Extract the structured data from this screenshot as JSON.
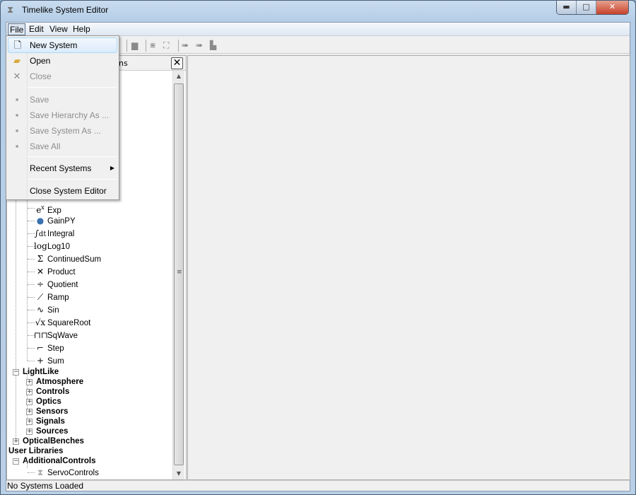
{
  "window": {
    "title": "Timelike System Editor",
    "buttons": [
      "minimize",
      "maximize",
      "close"
    ]
  },
  "menubar": [
    "File",
    "Edit",
    "View",
    "Help"
  ],
  "file_menu": [
    {
      "label": "New System",
      "icon": "new-document-icon",
      "enabled": true,
      "highlighted": true
    },
    {
      "label": "Open",
      "icon": "open-folder-icon",
      "enabled": true
    },
    {
      "label": "Close",
      "icon": "close-x-icon",
      "enabled": false
    },
    {
      "label": "Save",
      "icon": "floppy-icon",
      "enabled": false
    },
    {
      "label": "Save Hierarchy As ...",
      "icon": "floppy-icon",
      "enabled": false
    },
    {
      "label": "Save System As ...",
      "icon": "floppy-icon",
      "enabled": false
    },
    {
      "label": "Save All",
      "icon": "floppy-multiple-icon",
      "enabled": false
    },
    {
      "label": "Recent Systems",
      "submenu": true
    },
    {
      "label": "Close System Editor"
    }
  ],
  "panel": {
    "header_visible": "ns"
  },
  "tree": {
    "math_items": [
      {
        "label": "Exp",
        "icon": "e^x"
      },
      {
        "label": "GainPY",
        "icon": "python"
      },
      {
        "label": "Integral",
        "icon": "∫dt"
      },
      {
        "label": "Log10",
        "icon": "log"
      },
      {
        "label": "ContinuedSum",
        "icon": "Σ"
      },
      {
        "label": "Product",
        "icon": "×"
      },
      {
        "label": "Quotient",
        "icon": "÷"
      },
      {
        "label": "Ramp",
        "icon": "ramp"
      },
      {
        "label": "Sin",
        "icon": "sine"
      },
      {
        "label": "SquareRoot",
        "icon": "√x"
      },
      {
        "label": "SqWave",
        "icon": "square-wave"
      },
      {
        "label": "Step",
        "icon": "step"
      },
      {
        "label": "Sum",
        "icon": "+"
      }
    ],
    "lightlike": {
      "label": "LightLike",
      "children": [
        "Atmosphere",
        "Controls",
        "Optics",
        "Sensors",
        "Signals",
        "Sources"
      ]
    },
    "optical_benches": "OpticalBenches",
    "user_libraries": "User Libraries",
    "additional_controls": {
      "label": "AdditionalControls",
      "children": [
        "ServoControls"
      ]
    }
  },
  "status": "No Systems Loaded"
}
